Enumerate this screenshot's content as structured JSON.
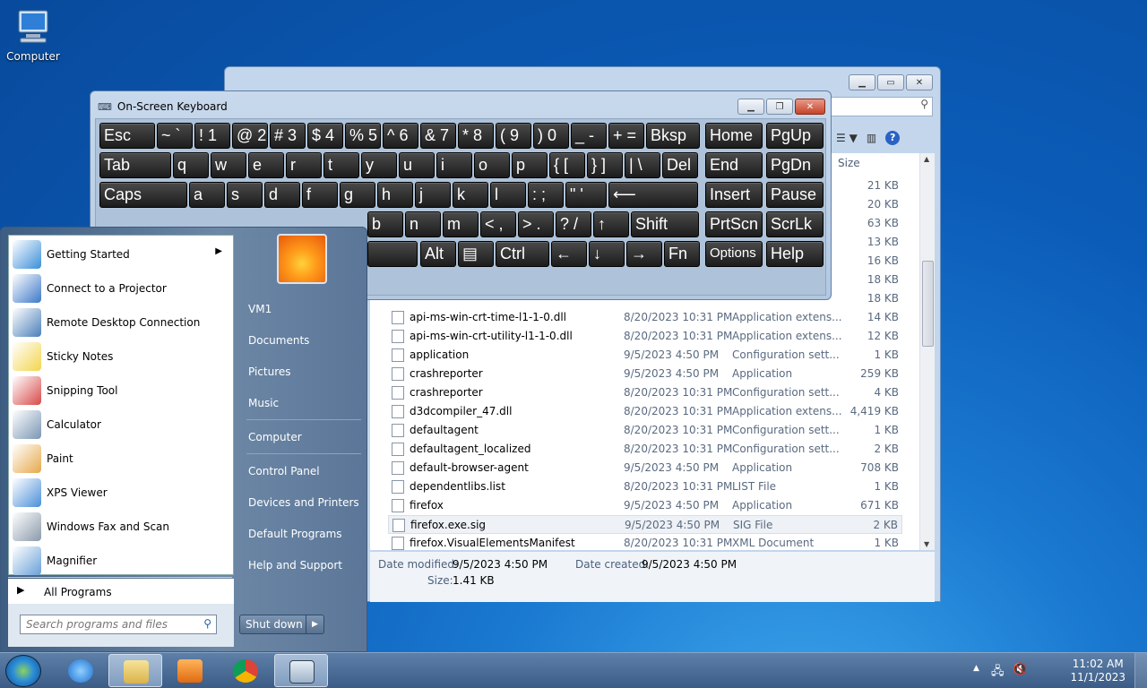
{
  "desktop": {
    "icon_label": "Computer"
  },
  "explorer": {
    "size_header": "Size",
    "sizes_top": [
      "21 KB",
      "20 KB",
      "63 KB",
      "13 KB",
      "16 KB",
      "18 KB",
      "18 KB"
    ],
    "rows": [
      {
        "name": "api-ms-win-crt-time-l1-1-0.dll",
        "date": "8/20/2023 10:31 PM",
        "type": "Application extens...",
        "size": "14 KB"
      },
      {
        "name": "api-ms-win-crt-utility-l1-1-0.dll",
        "date": "8/20/2023 10:31 PM",
        "type": "Application extens...",
        "size": "12 KB"
      },
      {
        "name": "application",
        "date": "9/5/2023 4:50 PM",
        "type": "Configuration sett...",
        "size": "1 KB"
      },
      {
        "name": "crashreporter",
        "date": "9/5/2023 4:50 PM",
        "type": "Application",
        "size": "259 KB"
      },
      {
        "name": "crashreporter",
        "date": "8/20/2023 10:31 PM",
        "type": "Configuration sett...",
        "size": "4 KB"
      },
      {
        "name": "d3dcompiler_47.dll",
        "date": "8/20/2023 10:31 PM",
        "type": "Application extens...",
        "size": "4,419 KB"
      },
      {
        "name": "defaultagent",
        "date": "8/20/2023 10:31 PM",
        "type": "Configuration sett...",
        "size": "1 KB"
      },
      {
        "name": "defaultagent_localized",
        "date": "8/20/2023 10:31 PM",
        "type": "Configuration sett...",
        "size": "2 KB"
      },
      {
        "name": "default-browser-agent",
        "date": "9/5/2023 4:50 PM",
        "type": "Application",
        "size": "708 KB"
      },
      {
        "name": "dependentlibs.list",
        "date": "8/20/2023 10:31 PM",
        "type": "LIST File",
        "size": "1 KB"
      },
      {
        "name": "firefox",
        "date": "9/5/2023 4:50 PM",
        "type": "Application",
        "size": "671 KB"
      },
      {
        "name": "firefox.exe.sig",
        "date": "9/5/2023 4:50 PM",
        "type": "SIG File",
        "size": "2 KB"
      },
      {
        "name": "firefox.VisualElementsManifest",
        "date": "8/20/2023 10:31 PM",
        "type": "XML Document",
        "size": "1 KB"
      }
    ],
    "details": {
      "frag": "g",
      "modified_label": "Date modified:",
      "modified": "9/5/2023 4:50 PM",
      "created_label": "Date created:",
      "created": "9/5/2023 4:50 PM",
      "size_label": "Size:",
      "size": "1.41 KB"
    }
  },
  "osk": {
    "title": "On-Screen Keyboard",
    "row1": [
      "Esc",
      "~ `",
      "! 1",
      "@ 2",
      "# 3",
      "$ 4",
      "% 5",
      "^ 6",
      "& 7",
      "* 8",
      "( 9",
      ") 0",
      "_ -",
      "+ =",
      "Bksp",
      "Home",
      "PgUp"
    ],
    "row2": [
      "Tab",
      "q",
      "w",
      "e",
      "r",
      "t",
      "y",
      "u",
      "i",
      "o",
      "p",
      "{ [",
      "} ]",
      "| \\",
      "Del",
      "End",
      "PgDn"
    ],
    "row3": [
      "Caps",
      "a",
      "s",
      "d",
      "f",
      "g",
      "h",
      "j",
      "k",
      "l",
      ": ;",
      "\" '",
      "⟵",
      "Insert",
      "Pause"
    ],
    "row4": [
      "b",
      "n",
      "m",
      "< ,",
      "> .",
      "? /",
      "↑",
      "Shift",
      "PrtScn",
      "ScrLk"
    ],
    "row5": [
      "",
      "Alt",
      "▤",
      "Ctrl",
      "←",
      "↓",
      "→",
      "Fn",
      "Options",
      "Help"
    ]
  },
  "start_menu": {
    "programs": [
      {
        "label": "Getting Started",
        "arrow": "▶"
      },
      {
        "label": "Connect to a Projector"
      },
      {
        "label": "Remote Desktop Connection"
      },
      {
        "label": "Sticky Notes"
      },
      {
        "label": "Snipping Tool"
      },
      {
        "label": "Calculator"
      },
      {
        "label": "Paint"
      },
      {
        "label": "XPS Viewer"
      },
      {
        "label": "Windows Fax and Scan"
      },
      {
        "label": "Magnifier"
      }
    ],
    "all_programs": "All Programs",
    "all_programs_arrow": "▶",
    "search_placeholder": "Search programs and files",
    "right_links": [
      "VM1",
      "Documents",
      "Pictures",
      "Music",
      "Computer",
      "Control Panel",
      "Devices and Printers",
      "Default Programs",
      "Help and Support"
    ],
    "shutdown": "Shut down",
    "shutdown_arrow": "▶"
  },
  "taskbar": {
    "clock_time": "11:02 AM",
    "clock_date": "11/1/2023",
    "tray_chevron": "▲"
  }
}
